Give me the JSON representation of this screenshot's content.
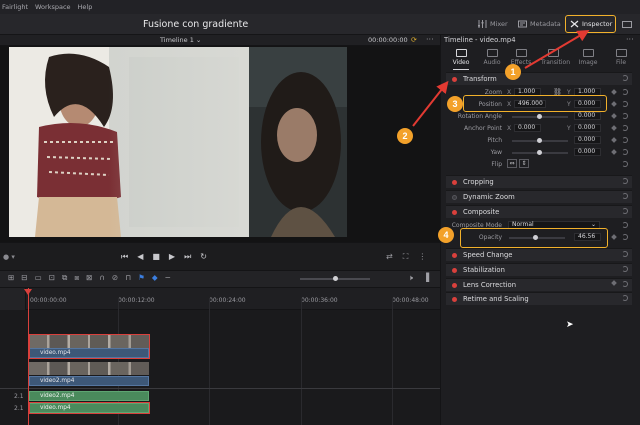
{
  "menu": [
    "Fairlight",
    "Workspace",
    "Help"
  ],
  "project_title": "Fusione con gradiente",
  "top_tabs": {
    "mixer": "Mixer",
    "metadata": "Metadata",
    "inspector": "Inspector"
  },
  "viewer": {
    "timeline_name": "Timeline 1",
    "timecode": "00:00:00:00"
  },
  "ruler": [
    "00:00:00:00",
    "00:00:12:00",
    "00:00:24:00",
    "00:00:36:00",
    "00:00:48:00"
  ],
  "track_labels": [
    "2.1",
    "2.1"
  ],
  "clips": {
    "v3": "video.mp4",
    "v2": "video2.mp4",
    "a2": "video2.mp4",
    "a1": "video.mp4"
  },
  "inspector": {
    "title": "Timeline - video.mp4",
    "tabs": [
      "Video",
      "Audio",
      "Effects",
      "Transition",
      "Image",
      "File"
    ],
    "transform": {
      "label": "Transform",
      "zoom_label": "Zoom",
      "zoom_x": "1.000",
      "zoom_y": "1.000",
      "position_label": "Position",
      "pos_x": "496.000",
      "pos_y": "0.000",
      "rotation_label": "Rotation Angle",
      "rotation": "0.000",
      "anchor_label": "Anchor Point",
      "anchor_x": "0.000",
      "anchor_y": "0.000",
      "pitch_label": "Pitch",
      "pitch": "0.000",
      "yaw_label": "Yaw",
      "yaw": "0.000",
      "flip_label": "Flip"
    },
    "sections": [
      "Cropping",
      "Dynamic Zoom",
      "Composite"
    ],
    "composite": {
      "mode_label": "Composite Mode",
      "mode": "Normal",
      "opacity_label": "Opacity",
      "opacity": "46.56"
    },
    "more_sections": [
      "Speed Change",
      "Stabilization",
      "Lens Correction",
      "Retime and Scaling"
    ]
  },
  "callouts": [
    "1",
    "2",
    "3",
    "4"
  ],
  "axis": {
    "x": "X",
    "y": "Y"
  },
  "colors": {
    "accent": "#d9403c",
    "callout": "#f3a12a",
    "clip_video": "#3d5878",
    "clip_audio": "#4a8a5c"
  }
}
